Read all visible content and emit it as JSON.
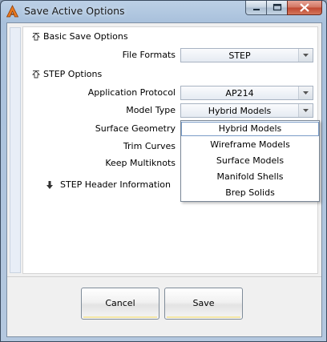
{
  "window": {
    "title": "Save Active Options"
  },
  "sections": {
    "basic": {
      "label": "Basic Save Options",
      "file_formats_label": "File Formats",
      "file_formats_value": "STEP"
    },
    "step": {
      "label": "STEP Options",
      "application_protocol_label": "Application Protocol",
      "application_protocol_value": "AP214",
      "model_type_label": "Model Type",
      "model_type_value": "Hybrid Models",
      "surface_geometry_label": "Surface Geometry",
      "trim_curves_label": "Trim Curves",
      "keep_multiknots_label": "Keep Multiknots"
    },
    "header": {
      "label": "STEP Header Information"
    }
  },
  "dropdown": {
    "items": [
      "Hybrid Models",
      "Wireframe Models",
      "Surface Models",
      "Manifold Shells",
      "Brep Solids"
    ]
  },
  "buttons": {
    "cancel": "Cancel",
    "save": "Save"
  },
  "colors": {
    "title_bar": "#a9c1dc",
    "close_button": "#c0462f",
    "selection_outline": "#7a9cc7"
  },
  "icons": {
    "app": "app-logo-icon",
    "minimize": "minimize-icon",
    "maximize": "maximize-icon",
    "close": "close-icon",
    "collapse": "collapse-icon",
    "expand": "expand-arrow-icon",
    "dropdown": "chevron-down-icon"
  }
}
